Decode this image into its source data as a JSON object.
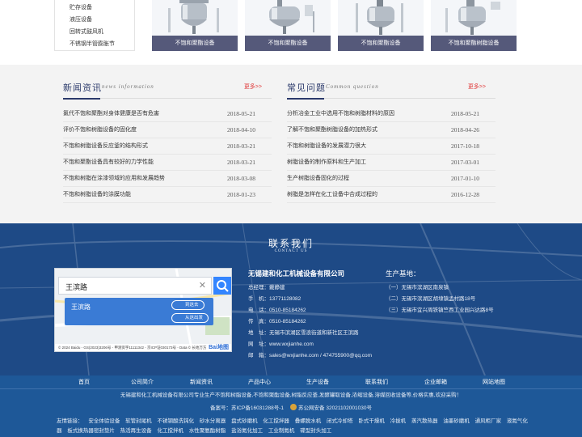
{
  "categories": [
    "贮存设备",
    "液压设备",
    "回转式鼓风机",
    "不锈钢半管膨胀节"
  ],
  "products": [
    {
      "caption": "不饱和聚酯设备"
    },
    {
      "caption": "不饱和聚酯设备"
    },
    {
      "caption": "不饱和聚酯设备"
    },
    {
      "caption": "不饱和聚酯树脂设备"
    }
  ],
  "news": {
    "title": "新闻资讯",
    "subtitle": "news information",
    "more": "更多>>",
    "items": [
      {
        "title": "氯代不饱和聚酯对身体健康是否有危害",
        "date": "2018-05-21"
      },
      {
        "title": "评价不饱和树脂设备的固化度",
        "date": "2018-04-10"
      },
      {
        "title": "不饱和树脂设备反应釜的结构形式",
        "date": "2018-03-21"
      },
      {
        "title": "不饱和聚酯设备具有较好的力学性能",
        "date": "2018-03-21"
      },
      {
        "title": "不饱和树脂在涂漆领域的应用和发展趋势",
        "date": "2018-03-08"
      },
      {
        "title": "不饱和树脂设备的涂膜功能",
        "date": "2018-01-23"
      }
    ]
  },
  "faq": {
    "title": "常见问题",
    "subtitle": "Common question",
    "more": "更多>>",
    "items": [
      {
        "title": "分析冶金工业中选用不饱和树脂材料的原因",
        "date": "2018-05-21"
      },
      {
        "title": "了解不饱和聚酯树脂设备的加热形式",
        "date": "2018-04-26"
      },
      {
        "title": "不饱和树脂设备的发展潜力很大",
        "date": "2017-10-18"
      },
      {
        "title": "树脂设备的制作原料和生产加工",
        "date": "2017-03-01"
      },
      {
        "title": "生产树脂设备固化的过程",
        "date": "2017-01-10"
      },
      {
        "title": "树脂是怎样在化工设备中合成过程的",
        "date": "2016-12-28"
      }
    ]
  },
  "contact": {
    "title": "联系我们",
    "subtitle": "CONTACT US",
    "map": {
      "search_value": "王滨路",
      "result_name": "王滨路",
      "btn_go": "到这去",
      "btn_more": "从这出发",
      "copyright": "© 2024 Baidu - GS(2023)3206号 - 甲测资字11111342 - 京ICP证030173号 - Data © 长地万方",
      "logo": "Bai地图"
    },
    "company": {
      "name": "无锡建和化工机械设备有限公司",
      "rows": [
        {
          "k": "总经理：",
          "v": "戴静建"
        },
        {
          "k": "手　机：",
          "v": "13771128082"
        },
        {
          "k": "电　话：",
          "v": "0510-85184262"
        },
        {
          "k": "传　真：",
          "v": "0510-85184262"
        },
        {
          "k": "地　址：",
          "v": "无锡市滨湖区雪浪街道和新社区王滨路"
        },
        {
          "k": "网　址：",
          "v": "www.wxjianhe.com"
        },
        {
          "k": "邮　箱：",
          "v": "sales@wxjianhe.com / 474755900@qq.com"
        }
      ]
    },
    "bases": {
      "title": "生产基地：",
      "items": [
        "（一）无锡市滨湖区南泉镇",
        "（二）无锡市滨湖区胡埭镇孟村路18号",
        "（三）无锡市宜兴周铁镇竺西工业园兴达路8号"
      ]
    }
  },
  "footer": {
    "nav": [
      "首页",
      "公司简介",
      "新闻资讯",
      "产品中心",
      "生产设备",
      "联系我们",
      "企业邮箱",
      "网站地图"
    ],
    "line1": "无锡建和化工机械设备有限公司专业生产不饱和树脂设备,不饱和聚酯设备,树脂反应釜,发酵罐取设备,浓缩设备,溶媒回收设备等,价格实惠,欢迎采购！",
    "icp_label": "备案号：",
    "icp": "苏ICP备16031288号-1",
    "police": "苏公网安备 32021102001030号",
    "links_label": "友情链接：",
    "links": [
      "安全体验设备",
      "软管封尾机",
      "不锈钢酸洗钝化",
      "砂水分离器",
      "盘式砂磨机",
      "化工搅拌器",
      "叠螺脱水机",
      "闭式冷却塔",
      "卧式干燥机",
      "冷拔机",
      "蒸汽散热器",
      "油墨砂磨机",
      "通风柜厂家",
      "液氮气化器",
      "板式换热器密封垫片",
      "热活再生设备",
      "化工搅拌机",
      "水性聚氨酯树脂",
      "盐浴氮化加工",
      "工业制氮机",
      "碟型封头加工"
    ]
  }
}
